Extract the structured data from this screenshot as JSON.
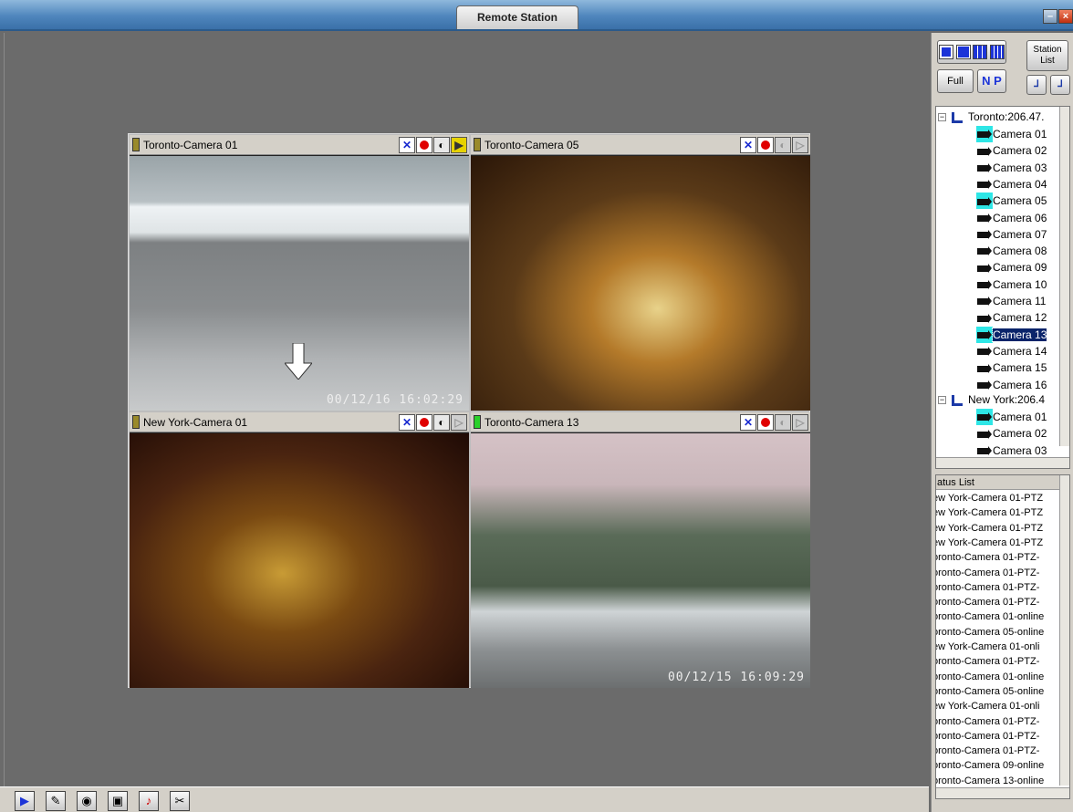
{
  "window": {
    "title": "Remote Station"
  },
  "cameras": [
    {
      "title": "Toronto-Camera 01",
      "timestamp": "00/12/16 16:02:29"
    },
    {
      "title": "Toronto-Camera 05",
      "timestamp": ""
    },
    {
      "title": "New York-Camera 01",
      "timestamp": ""
    },
    {
      "title": "Toronto-Camera 13",
      "timestamp": "00/12/15 16:09:29"
    }
  ],
  "toolbar": {
    "station_list": "Station List",
    "full": "Full",
    "n": "N",
    "p": "P"
  },
  "tree": {
    "stations": [
      {
        "label": "Toronto:206.47."
      },
      {
        "label": "New York:206.4"
      }
    ],
    "toronto_cameras": [
      "Camera 01",
      "Camera 02",
      "Camera 03",
      "Camera 04",
      "Camera 05",
      "Camera 06",
      "Camera 07",
      "Camera 08",
      "Camera 09",
      "Camera 10",
      "Camera 11",
      "Camera 12",
      "Camera 13",
      "Camera 14",
      "Camera 15",
      "Camera 16"
    ],
    "newyork_cameras": [
      "Camera 01",
      "Camera 02",
      "Camera 03"
    ]
  },
  "status_list": {
    "header": "atus List",
    "items": [
      "ew York-Camera 01-PTZ",
      "ew York-Camera 01-PTZ",
      "ew York-Camera 01-PTZ",
      "ew York-Camera 01-PTZ",
      "oronto-Camera 01-PTZ-",
      "oronto-Camera 01-PTZ-",
      "oronto-Camera 01-PTZ-",
      "oronto-Camera 01-PTZ-",
      "oronto-Camera 01-online",
      "oronto-Camera 05-online",
      "ew York-Camera 01-onli",
      "oronto-Camera 01-PTZ-",
      "oronto-Camera 01-online",
      "oronto-Camera 05-online",
      "ew York-Camera 01-onli",
      "oronto-Camera 01-PTZ-",
      "oronto-Camera 01-PTZ-",
      "oronto-Camera 01-PTZ-",
      "oronto-Camera 09-online",
      "oronto-Camera 13-online"
    ]
  },
  "colors": {
    "titlebar": "#4f86bd",
    "selection": "#0a246a",
    "highlight": "#2ee6e6",
    "record": "#e00000",
    "online": "#2bd12b"
  }
}
